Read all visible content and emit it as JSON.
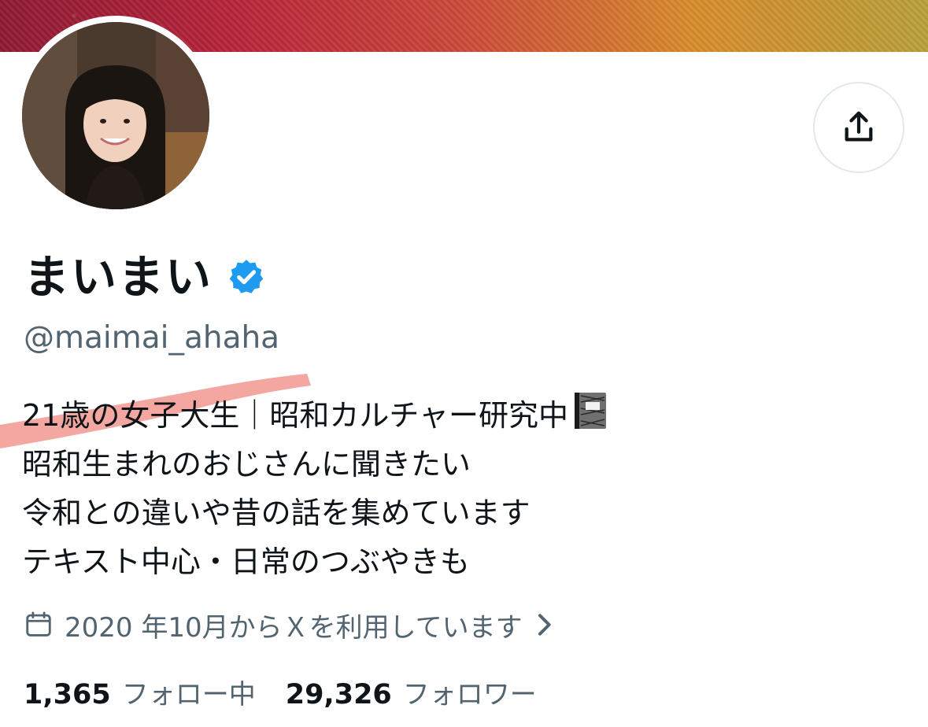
{
  "profile": {
    "display_name": "まいまい",
    "handle": "@maimai_ahaha",
    "bio_lines": [
      "21歳の女子大生｜昭和カルチャー研究中",
      "昭和生まれのおじさんに聞きたい",
      "令和との違いや昔の話を集めています",
      "テキスト中心・日常のつぶやきも"
    ],
    "joined_text": "2020 年10月からＸを利用しています",
    "following_count": "1,365",
    "following_label": "フォロー中",
    "followers_count": "29,326",
    "followers_label": "フォロワー"
  },
  "icons": {
    "share": "share-upload-icon",
    "verified": "verified-badge-icon",
    "bio_emoji": "notebook-icon",
    "joined": "calendar-icon",
    "joined_chevron": "chevron-right-icon"
  },
  "colors": {
    "verified": "#1d9bf0",
    "secondary_text": "#536471",
    "primary_text": "#0f1419",
    "highlight_marker": "#f08a80"
  }
}
